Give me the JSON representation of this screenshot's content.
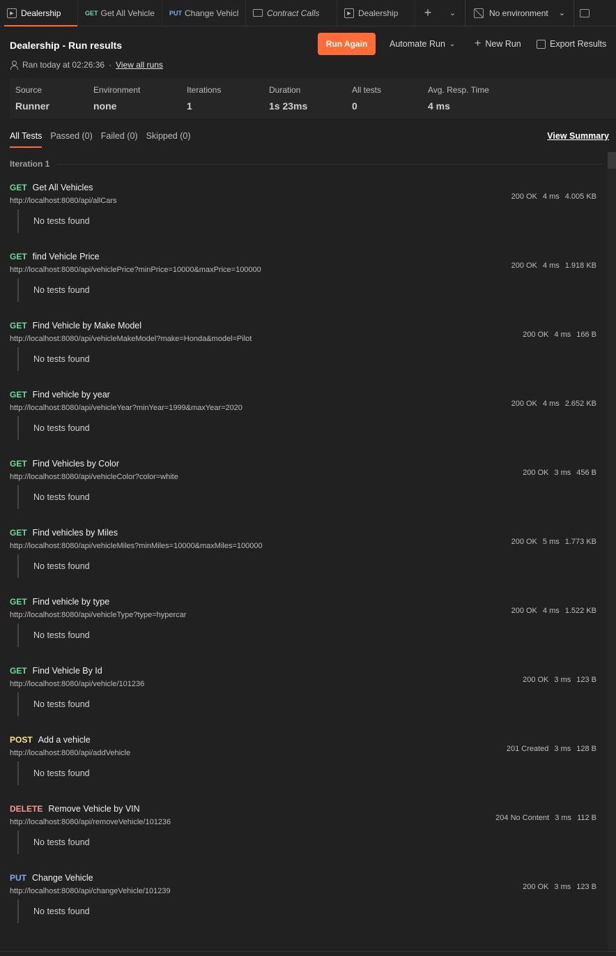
{
  "tabs": [
    {
      "label": "Dealership",
      "type": "runner",
      "active": true
    },
    {
      "label": "Get All Vehicle",
      "method": "GET"
    },
    {
      "label": "Change Vehicl",
      "method": "PUT"
    },
    {
      "label": "Contract Calls",
      "type": "folder"
    },
    {
      "label": "Dealership",
      "type": "runner"
    }
  ],
  "environment": {
    "label": "No environment"
  },
  "header": {
    "title": "Dealership - Run results",
    "ran": "Ran today at 02:26:36",
    "separator": "·",
    "view_all_runs": "View all runs",
    "run_again": "Run Again",
    "automate_run": "Automate Run",
    "new_run": "New Run",
    "export_results": "Export Results"
  },
  "summary": [
    {
      "label": "Source",
      "value": "Runner"
    },
    {
      "label": "Environment",
      "value": "none"
    },
    {
      "label": "Iterations",
      "value": "1"
    },
    {
      "label": "Duration",
      "value": "1s 23ms"
    },
    {
      "label": "All tests",
      "value": "0"
    },
    {
      "label": "Avg. Resp. Time",
      "value": "4 ms"
    }
  ],
  "filters": [
    "All Tests",
    "Passed (0)",
    "Failed (0)",
    "Skipped (0)"
  ],
  "view_summary": "View Summary",
  "iteration_label": "Iteration 1",
  "no_tests": "No tests found",
  "requests": [
    {
      "method": "GET",
      "name": "Get All Vehicles",
      "url": "http://localhost:8080/api/allCars",
      "status": "200 OK",
      "time": "4 ms",
      "size": "4.005 KB"
    },
    {
      "method": "GET",
      "name": "find Vehicle Price",
      "url": "http://localhost:8080/api/vehiclePrice?minPrice=10000&maxPrice=100000",
      "status": "200 OK",
      "time": "4 ms",
      "size": "1.918 KB"
    },
    {
      "method": "GET",
      "name": "Find Vehicle by Make Model",
      "url": "http://localhost:8080/api/vehicleMakeModel?make=Honda&model=Pilot",
      "status": "200 OK",
      "time": "4 ms",
      "size": "166 B"
    },
    {
      "method": "GET",
      "name": "Find vehicle by year",
      "url": "http://localhost:8080/api/vehicleYear?minYear=1999&maxYear=2020",
      "status": "200 OK",
      "time": "4 ms",
      "size": "2.652 KB"
    },
    {
      "method": "GET",
      "name": "Find Vehicles by Color",
      "url": "http://localhost:8080/api/vehicleColor?color=white",
      "status": "200 OK",
      "time": "3 ms",
      "size": "456 B"
    },
    {
      "method": "GET",
      "name": "Find vehicles by Miles",
      "url": "http://localhost:8080/api/vehicleMiles?minMiles=10000&maxMiles=100000",
      "status": "200 OK",
      "time": "5 ms",
      "size": "1.773 KB"
    },
    {
      "method": "GET",
      "name": "Find vehicle by type",
      "url": "http://localhost:8080/api/vehicleType?type=hypercar",
      "status": "200 OK",
      "time": "4 ms",
      "size": "1.522 KB"
    },
    {
      "method": "GET",
      "name": "Find Vehicle By Id",
      "url": "http://localhost:8080/api/vehicle/101236",
      "status": "200 OK",
      "time": "3 ms",
      "size": "123 B"
    },
    {
      "method": "POST",
      "name": "Add a vehicle",
      "url": "http://localhost:8080/api/addVehicle",
      "status": "201 Created",
      "time": "3 ms",
      "size": "128 B"
    },
    {
      "method": "DELETE",
      "name": "Remove Vehicle by VIN",
      "url": "http://localhost:8080/api/removeVehicle/101236",
      "status": "204 No Content",
      "time": "3 ms",
      "size": "112 B"
    },
    {
      "method": "PUT",
      "name": "Change Vehicle",
      "url": "http://localhost:8080/api/changeVehicle/101239",
      "status": "200 OK",
      "time": "3 ms",
      "size": "123 B"
    }
  ],
  "colors": {
    "accent": "#ff6c37",
    "get": "#6bdd9a",
    "post": "#ffe47e",
    "put": "#74aef6",
    "delete": "#f79a8e"
  }
}
